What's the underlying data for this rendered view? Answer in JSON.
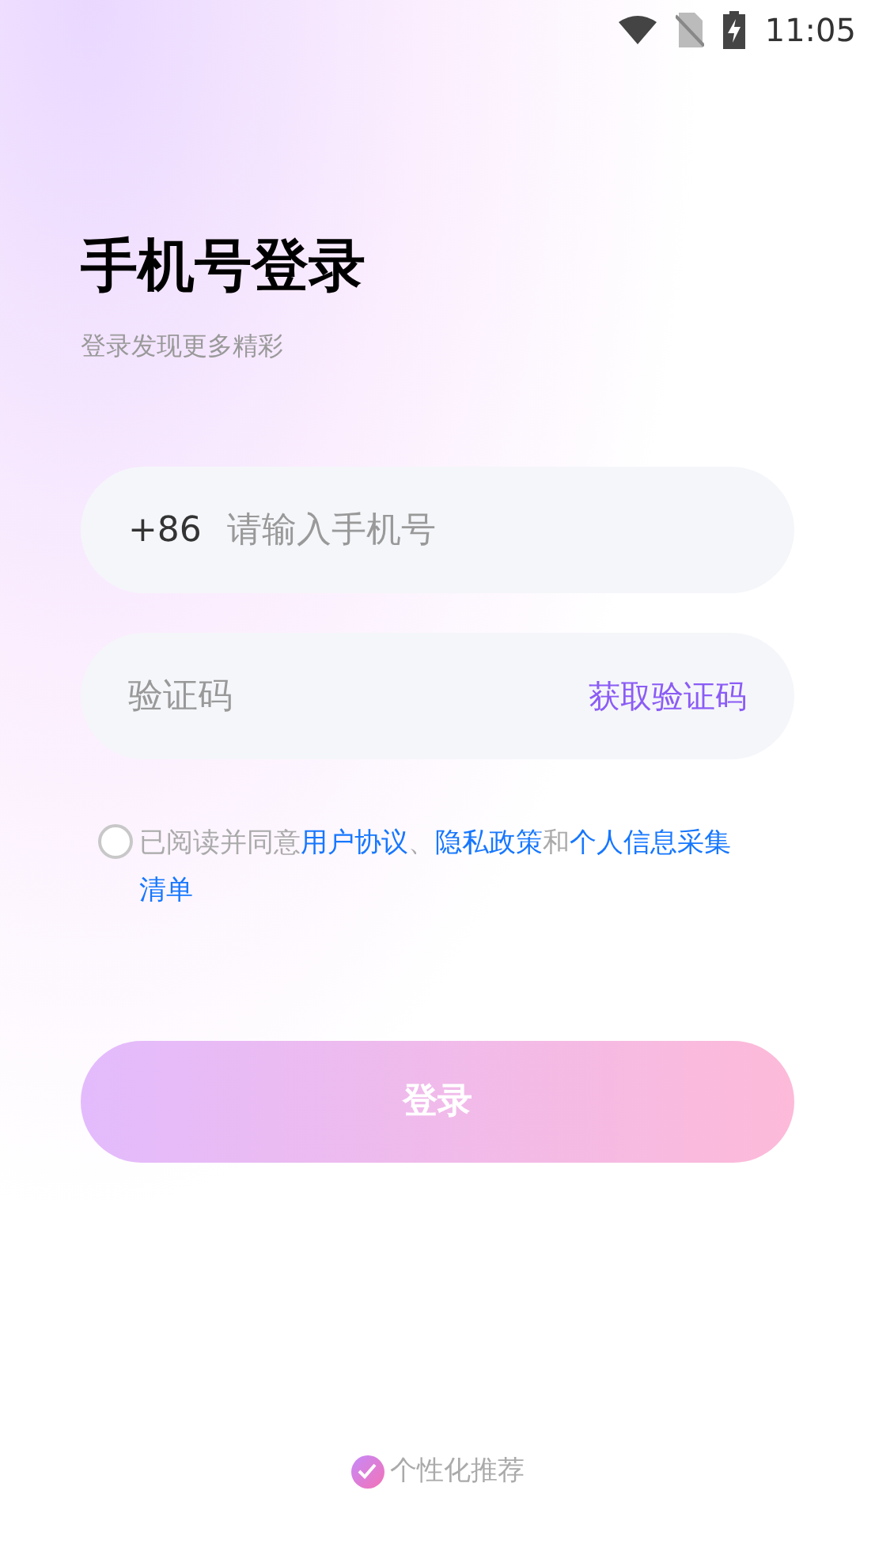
{
  "status_bar": {
    "time": "11:05"
  },
  "header": {
    "title": "手机号登录",
    "subtitle": "登录发现更多精彩"
  },
  "phone_field": {
    "country_code": "+86",
    "placeholder": "请输入手机号"
  },
  "code_field": {
    "placeholder": "验证码",
    "get_code": "获取验证码"
  },
  "agreement": {
    "checked": false,
    "segments": [
      {
        "kind": "plain",
        "text": "已阅读并同意"
      },
      {
        "kind": "link",
        "text": "用户协议"
      },
      {
        "kind": "plain",
        "text": "、"
      },
      {
        "kind": "link",
        "text": "隐私政策"
      },
      {
        "kind": "plain",
        "text": "和"
      },
      {
        "kind": "link",
        "text": "个人信息采集"
      },
      {
        "kind": "link",
        "text": "清单"
      }
    ]
  },
  "login_button": {
    "label": "登录",
    "disabled": true
  },
  "personalized": {
    "label": "个性化推荐",
    "checked": true
  }
}
